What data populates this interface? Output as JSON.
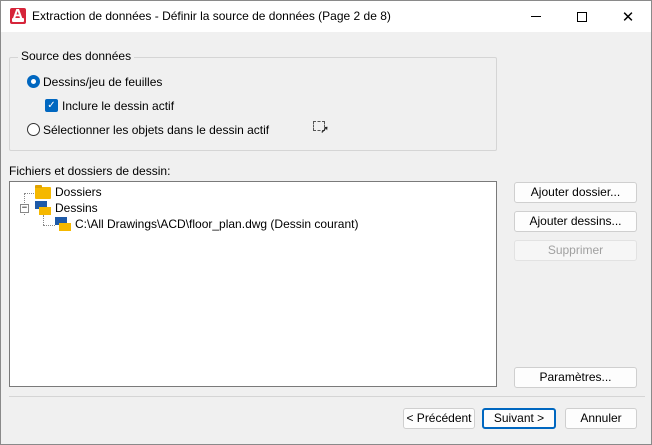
{
  "window": {
    "title": "Extraction de données - Définir la source de données (Page 2 de 8)",
    "app_icon": "autocad-app-icon",
    "controls": {
      "minimize": "minimize-icon",
      "maximize": "maximize-icon",
      "close": "✕"
    }
  },
  "source_group": {
    "label": "Source des données",
    "options": [
      {
        "label": "Dessins/jeu de feuilles",
        "selected": true
      },
      {
        "label": "Sélectionner les objets dans le dessin actif",
        "selected": false
      }
    ],
    "include_active": {
      "label": "Inclure le dessin actif",
      "checked": true
    },
    "select_objects_icon": "select-objects-icon"
  },
  "files": {
    "label": "Fichiers et dossiers de dessin:",
    "tree": [
      {
        "label": "Dossiers",
        "icon": "folder-icon"
      },
      {
        "label": "Dessins",
        "icon": "drawings-icon",
        "expanded": true,
        "children": [
          {
            "label": "C:\\All Drawings\\ACD\\floor_plan.dwg (Dessin courant)",
            "icon": "dwg-file-icon"
          }
        ]
      }
    ]
  },
  "side_buttons": {
    "add_folder": "Ajouter dossier...",
    "add_drawings": "Ajouter dessins...",
    "remove": "Supprimer",
    "settings": "Paramètres..."
  },
  "footer_buttons": {
    "previous": "< Précédent",
    "next": "Suivant >",
    "cancel": "Annuler"
  },
  "colors": {
    "accent": "#0067c0",
    "folder": "#f5b800",
    "drawing_blue": "#1e5aa8",
    "brand": "#d6253a"
  }
}
